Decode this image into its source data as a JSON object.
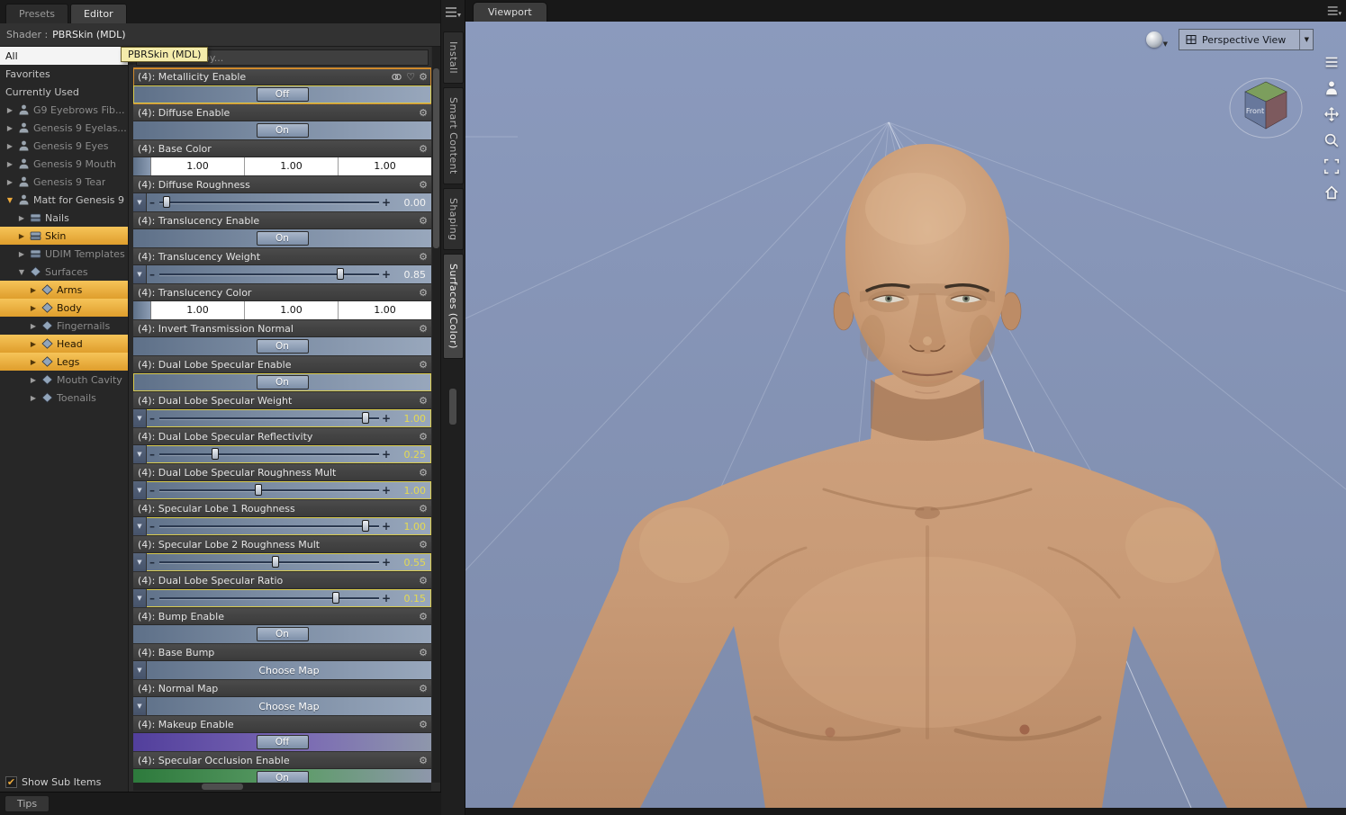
{
  "colors": {
    "accent_yellow": "#edaa3c",
    "highlight_border": "#d9cb4e",
    "metallicity_border": "#cf8a2d",
    "viewport_bg": "#8292b4",
    "skin_base": "#c79c7c",
    "panel_bg": "#2b2b2b"
  },
  "top_tabs": {
    "presets": "Presets",
    "editor": "Editor"
  },
  "shader_row": {
    "prefix": "Shader :",
    "name": "PBRSkin (MDL)"
  },
  "tooltip": {
    "text": "PBRSkin (MDL)"
  },
  "filter": {
    "placeholder": "text to filter by..."
  },
  "sidebar": {
    "items": [
      {
        "label": "All",
        "style": "selected-plain"
      },
      {
        "label": "Favorites",
        "style": "plain"
      },
      {
        "label": "Currently Used",
        "style": "plain"
      },
      {
        "label": "G9 Eyebrows Fib...",
        "indent": 0,
        "arrow": "right",
        "icon": "figure",
        "dim": true
      },
      {
        "label": "Genesis 9 Eyelas...",
        "indent": 0,
        "arrow": "right",
        "icon": "figure",
        "dim": true
      },
      {
        "label": "Genesis 9 Eyes",
        "indent": 0,
        "arrow": "right",
        "icon": "figure",
        "dim": true
      },
      {
        "label": "Genesis 9 Mouth",
        "indent": 0,
        "arrow": "right",
        "icon": "figure",
        "dim": true
      },
      {
        "label": "Genesis 9 Tear",
        "indent": 0,
        "arrow": "right",
        "icon": "figure",
        "dim": true
      },
      {
        "label": "Matt for Genesis 9",
        "indent": 0,
        "arrow": "down",
        "icon": "figure",
        "accent": true
      },
      {
        "label": "Nails",
        "indent": 1,
        "arrow": "right",
        "icon": "folder"
      },
      {
        "label": "Skin",
        "indent": 1,
        "arrow": "right",
        "icon": "folder",
        "selected": true
      },
      {
        "label": "UDIM Templates",
        "indent": 1,
        "arrow": "right",
        "icon": "folder",
        "dim": true
      },
      {
        "label": "Surfaces",
        "indent": 1,
        "arrow": "down",
        "icon": "surface",
        "dim": true
      },
      {
        "label": "Arms",
        "indent": 2,
        "arrow": "right",
        "icon": "surface",
        "selected": true
      },
      {
        "label": "Body",
        "indent": 2,
        "arrow": "right",
        "icon": "surface",
        "selected": true
      },
      {
        "label": "Fingernails",
        "indent": 2,
        "arrow": "right",
        "icon": "surface",
        "dim": true
      },
      {
        "label": "Head",
        "indent": 2,
        "arrow": "right",
        "icon": "surface",
        "selected": true
      },
      {
        "label": "Legs",
        "indent": 2,
        "arrow": "right",
        "icon": "surface",
        "selected": true
      },
      {
        "label": "Mouth Cavity",
        "indent": 2,
        "arrow": "right",
        "icon": "surface",
        "dim": true
      },
      {
        "label": "Toenails",
        "indent": 2,
        "arrow": "right",
        "icon": "surface",
        "dim": true
      }
    ]
  },
  "properties": {
    "items": [
      {
        "label": "(4): Metallicity Enable",
        "type": "toggle",
        "value": "Off",
        "highlight": "block",
        "header_icons": [
          "link-icon",
          "heart-icon",
          "gear-icon"
        ]
      },
      {
        "label": "(4): Diffuse Enable",
        "type": "toggle",
        "value": "On"
      },
      {
        "label": "(4): Base Color",
        "type": "color",
        "values": [
          "1.00",
          "1.00",
          "1.00"
        ]
      },
      {
        "label": "(4): Diffuse Roughness",
        "type": "slider",
        "value": "0.00",
        "pos": 0.04
      },
      {
        "label": "(4): Translucency Enable",
        "type": "toggle",
        "value": "On"
      },
      {
        "label": "(4): Translucency Weight",
        "type": "slider",
        "value": "0.85",
        "pos": 0.82
      },
      {
        "label": "(4): Translucency Color",
        "type": "color",
        "values": [
          "1.00",
          "1.00",
          "1.00"
        ]
      },
      {
        "label": "(4): Invert Transmission Normal",
        "type": "toggle",
        "value": "On"
      },
      {
        "label": "(4): Dual Lobe Specular Enable",
        "type": "toggle",
        "value": "On",
        "highlight": "control"
      },
      {
        "label": "(4): Dual Lobe Specular Weight",
        "type": "slider",
        "value": "1.00",
        "pos": 0.93,
        "highlight": "control"
      },
      {
        "label": "(4): Dual Lobe Specular Reflectivity",
        "type": "slider",
        "value": "0.25",
        "pos": 0.26,
        "highlight": "control"
      },
      {
        "label": "(4): Dual Lobe Specular Roughness Mult",
        "type": "slider",
        "value": "1.00",
        "pos": 0.45,
        "highlight": "control"
      },
      {
        "label": "(4): Specular Lobe 1 Roughness",
        "type": "slider",
        "value": "1.00",
        "pos": 0.93,
        "highlight": "control"
      },
      {
        "label": "(4): Specular Lobe 2 Roughness Mult",
        "type": "slider",
        "value": "0.55",
        "pos": 0.53,
        "highlight": "control"
      },
      {
        "label": "(4): Dual Lobe Specular Ratio",
        "type": "slider",
        "value": "0.15",
        "pos": 0.8,
        "highlight": "control"
      },
      {
        "label": "(4): Bump Enable",
        "type": "toggle",
        "value": "On"
      },
      {
        "label": "(4): Base Bump",
        "type": "map",
        "value": "Choose Map"
      },
      {
        "label": "(4): Normal Map",
        "type": "map",
        "value": "Choose Map"
      },
      {
        "label": "(4): Makeup Enable",
        "type": "toggle",
        "value": "Off",
        "gradient": "purple"
      },
      {
        "label": "(4): Specular Occlusion Enable",
        "type": "toggle",
        "value": "On",
        "gradient": "green"
      }
    ]
  },
  "footer": {
    "show_sub_items": "Show Sub Items",
    "tips": "Tips"
  },
  "tab_strip": {
    "tabs": [
      {
        "label": "Install"
      },
      {
        "label": "Smart Content"
      },
      {
        "label": "Shaping"
      },
      {
        "label": "Surfaces (Color)",
        "active": true
      }
    ]
  },
  "viewport": {
    "tab": "Viewport",
    "view_selector": "Perspective View",
    "cube_front_label": "Front",
    "toolbar_icons": [
      "style-lines-icon",
      "frame-figure-icon",
      "pan-icon",
      "zoom-icon",
      "aspect-frame-icon",
      "home-icon"
    ]
  }
}
